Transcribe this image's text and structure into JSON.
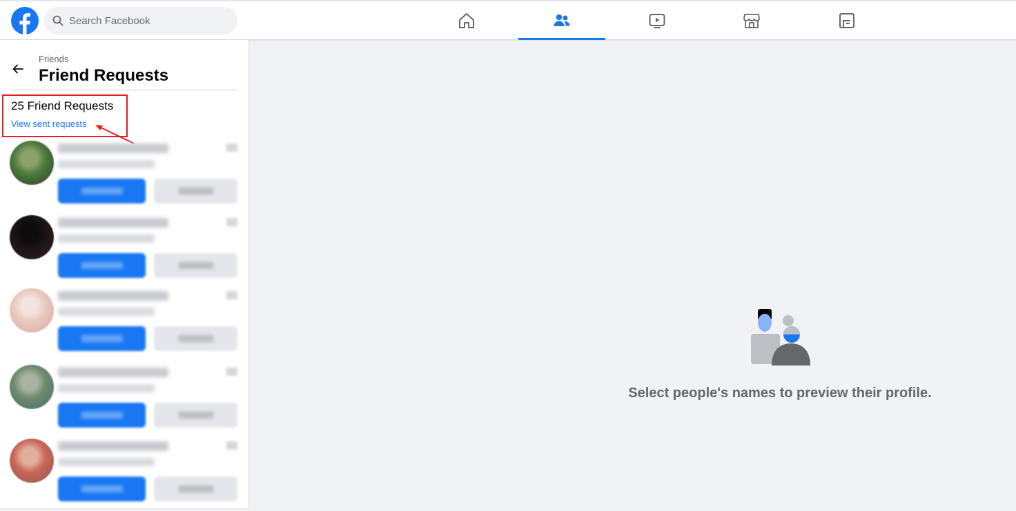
{
  "header": {
    "logo": "facebook-logo",
    "search": {
      "placeholder": "Search Facebook",
      "value": ""
    },
    "tabs": [
      {
        "name": "home",
        "icon": "home-icon",
        "active": false
      },
      {
        "name": "friends",
        "icon": "friends-icon",
        "active": true
      },
      {
        "name": "watch",
        "icon": "watch-icon",
        "active": false
      },
      {
        "name": "marketplace",
        "icon": "marketplace-icon",
        "active": false
      },
      {
        "name": "gaming",
        "icon": "gaming-icon",
        "active": false
      }
    ]
  },
  "sidebar": {
    "breadcrumb": "Friends",
    "title": "Friend Requests",
    "count_label": "25 Friend Requests",
    "sent_link": "View sent requests",
    "requests": [
      {
        "avatar_colors": [
          "#4c7a3a",
          "#2e3b2a",
          "#8aa36d"
        ]
      },
      {
        "avatar_colors": [
          "#1a1416",
          "#3a1c1e",
          "#0d0b0c"
        ]
      },
      {
        "avatar_colors": [
          "#e8c9c0",
          "#d9a79b",
          "#f2e4de"
        ]
      },
      {
        "avatar_colors": [
          "#6e8a6c",
          "#4a6b74",
          "#a8b3a1"
        ]
      },
      {
        "avatar_colors": [
          "#c9665a",
          "#8a5a50",
          "#e0b09a"
        ]
      }
    ]
  },
  "main": {
    "empty_message": "Select people's names to preview their profile."
  },
  "colors": {
    "accent": "#1877f2",
    "annotation": "#e51c23",
    "background": "#f0f2f5"
  }
}
